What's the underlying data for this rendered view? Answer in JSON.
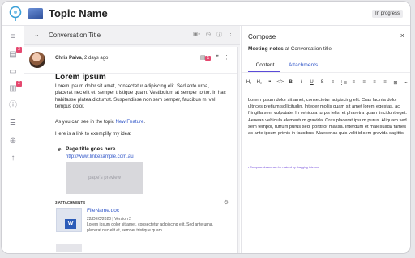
{
  "app": {
    "topic_title": "Topic Name",
    "status": "In progress"
  },
  "rail": {
    "items": [
      {
        "icon": "menu-icon",
        "glyph": "≡"
      },
      {
        "icon": "document-stack-icon",
        "glyph": "▤",
        "badge": "3"
      },
      {
        "icon": "note-icon",
        "glyph": "▭"
      },
      {
        "icon": "notes-edit-icon",
        "glyph": "▥",
        "badge": "2"
      },
      {
        "icon": "info-icon",
        "glyph": "ⓘ"
      },
      {
        "icon": "filter-lines-icon",
        "glyph": "≣"
      },
      {
        "icon": "add-circle-icon",
        "glyph": "⊕"
      },
      {
        "icon": "arrow-up-icon",
        "glyph": "↑"
      }
    ]
  },
  "conversation": {
    "title": "Conversation Title",
    "header_icons": [
      "bookmark-icon",
      "clock-icon",
      "alert-icon",
      "more-icon"
    ],
    "message": {
      "author": "Chris Paiva",
      "time": ", 2 days ago",
      "attach_badge": "1",
      "heading": "Lorem ipsum",
      "paragraph": "Lorem ipsum dolor sit amet, consectetur adipiscing elit. Sed ante urna, placerat nec elit et, semper tristique quam. Vestibulum at semper tortor. In hac habitasse platea dictumst. Suspendisse non sem semper, faucibus mi vel, tempus dolor.",
      "topic_line_prefix": "As you can see in the topic ",
      "topic_link": "New Feature",
      "topic_line_suffix": ".",
      "link_intro": "Here is a link to exemplify my idea:",
      "preview_title": "Page title goes here",
      "preview_url": "http://www.linkexample.com.au",
      "preview_image_label": "page's preview",
      "attachments_label": "3 ATTACHMENTS",
      "file_name": "FileName.doc",
      "file_meta": "22/DEC/2020 | Version 2",
      "file_desc": "Lorem ipsum dolor sit amet, consectetur adipiscing elit. Sed ante urna, placerat nec elit et, semper tristique quam.",
      "file_icon_letter": "W"
    }
  },
  "compose": {
    "title": "Compose",
    "close_glyph": "×",
    "sub_bold": "Meeting notes",
    "sub_rest": " at Conversation title",
    "tabs": [
      "Content",
      "Attachments"
    ],
    "toolbar": [
      "H₁",
      "H₂",
      "❞",
      "</>",
      "B",
      "I",
      "U",
      "S",
      "≡",
      "⋮≡",
      "≡",
      "≡",
      "≡",
      "≡",
      "⊞",
      "⌁"
    ],
    "body": "Lorem ipsum dolor sit amet, consectetur adipiscing elit. Cras lacinia dolor ultrices pretium sollicitudin. Integer mollis quam sit amet lorem egestas, ac fringilla sem vulputate. In vehicula turpis felis, et pharetra quam tincidunt eget. Aenean vehicula elementum gravida. Cras placerat ipsum purus. Aliquam sed sem tempor, rutrum purus sed, porttitor massa. Interdum et malesuada fames ac ante ipsum primis in faucibus. Maecenas quis velit id sem gravida sagittis.",
    "hint": "• Compose drawer can be resized by dragging this box"
  },
  "colors": {
    "accent": "#5a4bd8",
    "link": "#2f55c8",
    "badge": "#e5486f"
  }
}
